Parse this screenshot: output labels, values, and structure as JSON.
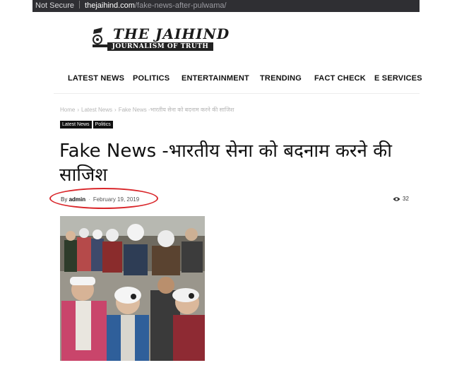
{
  "browser": {
    "security_label": "Not Secure",
    "domain": "thejaihind.com",
    "path": "/fake-news-after-pulwama/"
  },
  "logo": {
    "name": "THE JAIHIND",
    "tagline": "JOURNALISM OF TRUTH"
  },
  "nav": {
    "items": [
      "LATEST NEWS",
      "POLITICS",
      "ENTERTAINMENT",
      "TRENDING",
      "FACT CHECK",
      "E SERVICES"
    ]
  },
  "breadcrumb": [
    "Home",
    "Latest News",
    "Fake News -भारतीय सेना को बदनाम करने की साजिश"
  ],
  "categories": [
    "Latest News",
    "Politics"
  ],
  "article": {
    "title": "Fake News -भारतीय सेना को बदनाम करने की साजिश",
    "by_label": "By",
    "author": "admin",
    "date": "February 19, 2019",
    "views": "32"
  },
  "icons": {
    "views": "eye-icon",
    "logo": "typewriter-icon"
  },
  "colors": {
    "address_bar": "#2f2f33",
    "highlight_oval": "#d9262a",
    "category_badge": "#111111"
  }
}
